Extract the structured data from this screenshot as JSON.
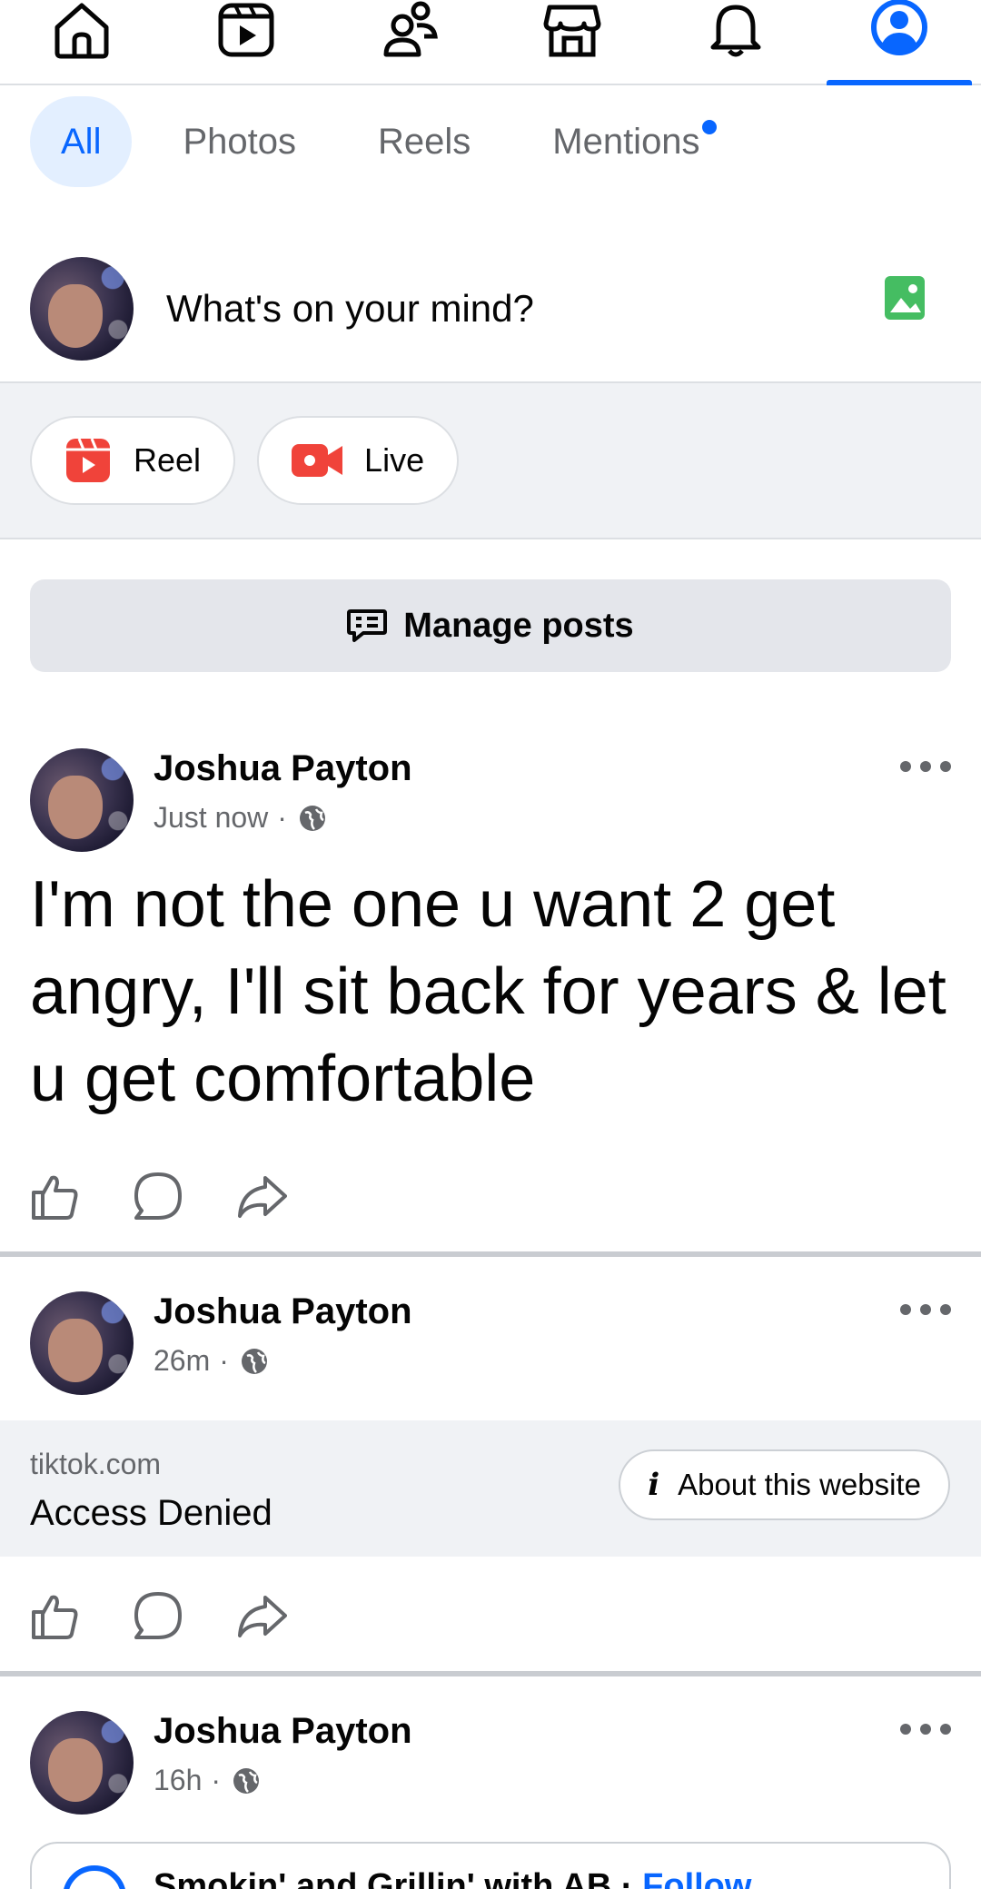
{
  "nav": {
    "items": [
      {
        "icon": "home-icon"
      },
      {
        "icon": "video-icon"
      },
      {
        "icon": "friends-icon"
      },
      {
        "icon": "marketplace-icon"
      },
      {
        "icon": "bell-icon"
      },
      {
        "icon": "profile-icon",
        "active": true
      }
    ],
    "accent": "#0866ff"
  },
  "filters": {
    "tabs": [
      {
        "label": "All",
        "active": true
      },
      {
        "label": "Photos"
      },
      {
        "label": "Reels"
      },
      {
        "label": "Mentions",
        "badge": true
      }
    ]
  },
  "composer": {
    "placeholder": "What's on your mind?"
  },
  "create": {
    "reel_label": "Reel",
    "live_label": "Live"
  },
  "manage_posts_label": "Manage posts",
  "posts": [
    {
      "author": "Joshua Payton",
      "time": "Just now",
      "text": "I'm not the one u want 2 get angry, I'll sit back for years & let u get comfortable"
    },
    {
      "author": "Joshua Payton",
      "time": "26m",
      "link": {
        "domain": "tiktok.com",
        "title": "Access Denied",
        "about_label": "About this website"
      }
    },
    {
      "author": "Joshua Payton",
      "time": "16h",
      "shared_page": "Smokin' and Grillin' with AB",
      "follow_label": "Follow"
    }
  ],
  "meta_separator": "·",
  "colors": {
    "accent": "#0866ff",
    "secondary_text": "#65676b",
    "reel_red": "#f0433a",
    "photo_green": "#45bd62"
  }
}
